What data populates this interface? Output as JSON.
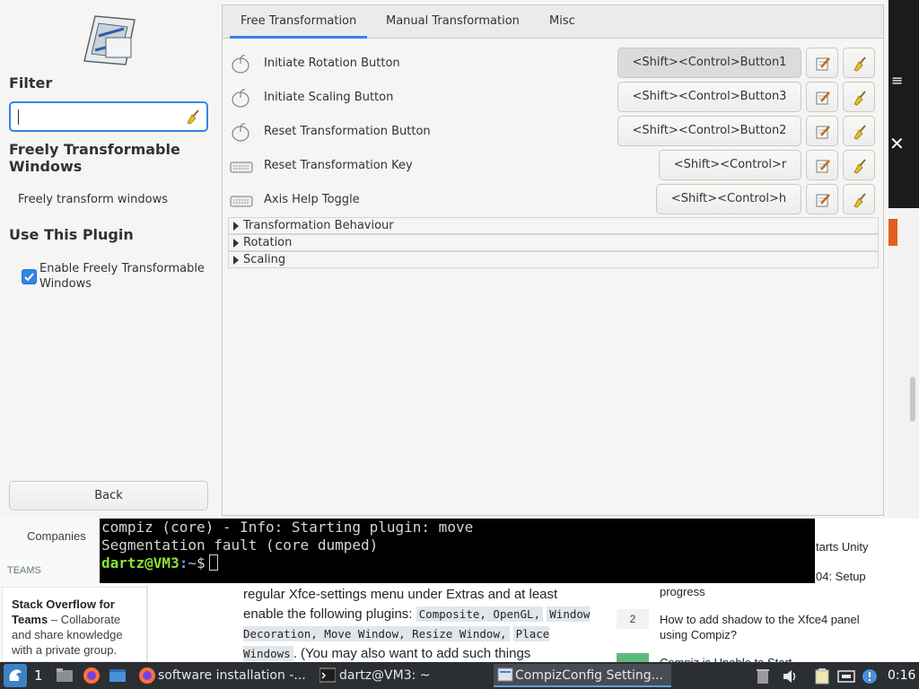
{
  "ccsm": {
    "filter": {
      "heading": "Filter",
      "value": "",
      "placeholder": ""
    },
    "plugin": {
      "title": "Freely Transformable Windows",
      "description": "Freely transform windows",
      "use_heading": "Use This Plugin",
      "enable_label": "Enable Freely Transformable Windows",
      "enabled": true
    },
    "back_label": "Back",
    "tabs": [
      {
        "label": "Free Transformation",
        "active": true
      },
      {
        "label": "Manual Transformation",
        "active": false
      },
      {
        "label": "Misc",
        "active": false
      }
    ],
    "settings": [
      {
        "label": "Initiate Rotation Button",
        "binding": "<Shift><Control>Button1",
        "icon": "mouse-icon"
      },
      {
        "label": "Initiate Scaling Button",
        "binding": "<Shift><Control>Button3",
        "icon": "mouse-icon"
      },
      {
        "label": "Reset Transformation Button",
        "binding": "<Shift><Control>Button2",
        "icon": "mouse-icon"
      },
      {
        "label": "Reset Transformation Key",
        "binding": "<Shift><Control>r",
        "icon": "keyboard-icon"
      },
      {
        "label": "Axis Help Toggle",
        "binding": "<Shift><Control>h",
        "icon": "keyboard-icon"
      }
    ],
    "sections": [
      {
        "label": "Transformation Behaviour"
      },
      {
        "label": "Rotation"
      },
      {
        "label": "Scaling"
      }
    ]
  },
  "terminal": {
    "lines": [
      "compiz (core) - Info: Starting plugin: move",
      "Segmentation fault (core dumped)"
    ],
    "prompt_user": "dartz@VM3",
    "prompt_path": ":~",
    "prompt_symbol": "$"
  },
  "background_page": {
    "nav_companies": "Companies",
    "nav_teams": "TEAMS",
    "teams_title": "Stack Overflow for Teams",
    "teams_text": " – Collaborate and share knowledge with a private group.",
    "article_text_1": "regular Xfce-settings menu under Extras and at least enable the following plugins: ",
    "article_code_1": "Composite, OpenGL,",
    "article_code_2": "Window Decoration, Move Window, Resize Window,",
    "article_code_3": "Place Windows",
    "article_text_2": ". (You may also want to add such things",
    "sidebar": {
      "q1_fragment": "tarts Unity",
      "q2_fragment_a": "04: Setup",
      "q2_fragment_b": "progress",
      "q3_count": "2",
      "q3_title": "How to add shadow to the Xfce4 panel using Compiz?",
      "q4_fragment": "Compiz is Unable to Start"
    }
  },
  "taskbar": {
    "workspace": "1",
    "tasks": [
      {
        "label": "software installation -...",
        "icon": "firefox-icon",
        "active": false
      },
      {
        "label": "dartz@VM3: ~",
        "icon": "terminal-icon",
        "active": false
      },
      {
        "label": "CompizConfig Setting...",
        "icon": "ccsm-icon",
        "active": true
      }
    ],
    "clock": "0:16"
  },
  "colors": {
    "accent": "#3584e4",
    "taskbar_bg": "#2b2e33",
    "terminal_bg": "#000000",
    "prompt_user": "#8ae234",
    "prompt_path": "#729fcf"
  }
}
